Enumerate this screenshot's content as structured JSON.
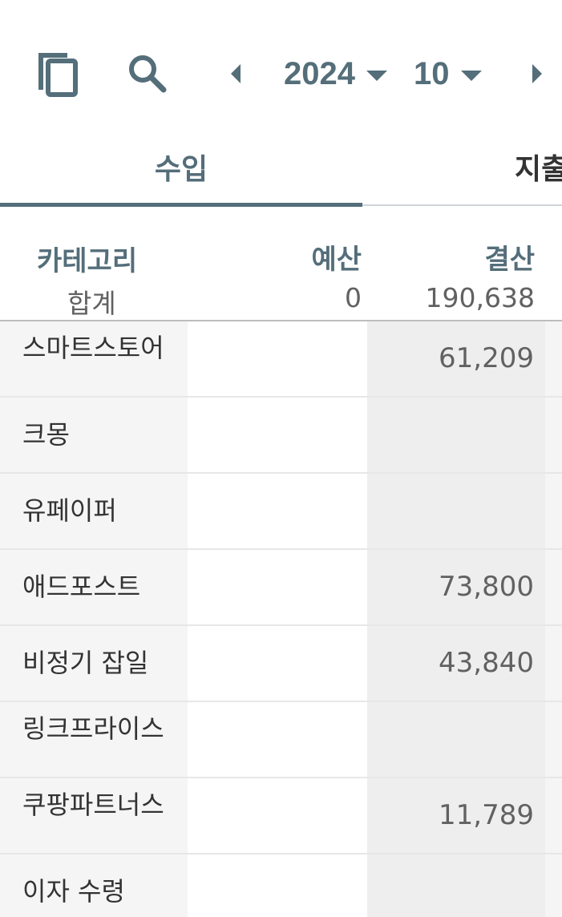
{
  "toolbar": {
    "copy_icon": "copy-icon",
    "search_icon": "search-icon",
    "prev_icon": "caret-left-icon",
    "next_icon": "caret-right-icon",
    "year": "2024",
    "month": "10"
  },
  "tabs": [
    {
      "label": "수입",
      "active": true
    },
    {
      "label": "지출",
      "active": false
    }
  ],
  "table": {
    "headers": {
      "category": "카테고리",
      "budget": "예산",
      "actual": "결산"
    },
    "total": {
      "label": "합계",
      "budget": "0",
      "actual": "190,638"
    },
    "rows": [
      {
        "category": "스마트스토어",
        "budget": "",
        "actual": "61,209"
      },
      {
        "category": "크몽",
        "budget": "",
        "actual": ""
      },
      {
        "category": "유페이퍼",
        "budget": "",
        "actual": ""
      },
      {
        "category": "애드포스트",
        "budget": "",
        "actual": "73,800"
      },
      {
        "category": "비정기 잡일",
        "budget": "",
        "actual": "43,840"
      },
      {
        "category": "링크프라이스",
        "budget": "",
        "actual": ""
      },
      {
        "category": "쿠팡파트너스",
        "budget": "",
        "actual": "11,789"
      },
      {
        "category": "이자 수령",
        "budget": "",
        "actual": ""
      }
    ]
  },
  "colors": {
    "accent": "#546e7a",
    "text": "#333333",
    "muted": "#616161"
  }
}
